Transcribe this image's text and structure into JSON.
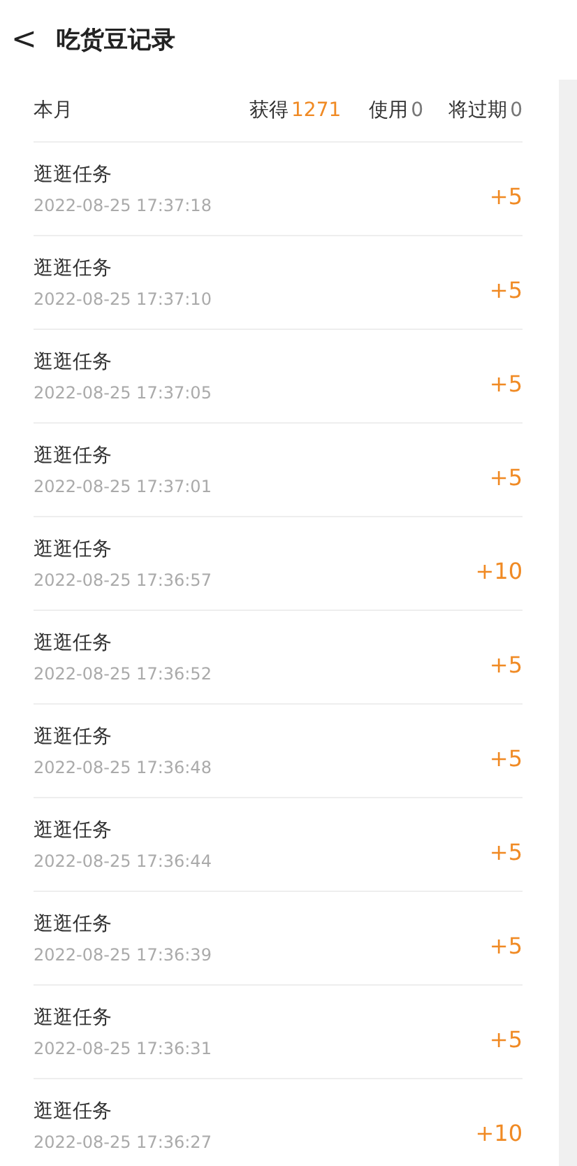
{
  "header": {
    "back": "<",
    "title": "吃货豆记录"
  },
  "summary": {
    "period": "本月",
    "earned_label": "获得",
    "earned": "1271",
    "used_label": "使用",
    "used": "0",
    "expiring_label": "将过期",
    "expiring": "0"
  },
  "records": [
    {
      "title": "逛逛任务",
      "time": "2022-08-25 17:37:18",
      "amount": "+5"
    },
    {
      "title": "逛逛任务",
      "time": "2022-08-25 17:37:10",
      "amount": "+5"
    },
    {
      "title": "逛逛任务",
      "time": "2022-08-25 17:37:05",
      "amount": "+5"
    },
    {
      "title": "逛逛任务",
      "time": "2022-08-25 17:37:01",
      "amount": "+5"
    },
    {
      "title": "逛逛任务",
      "time": "2022-08-25 17:36:57",
      "amount": "+10"
    },
    {
      "title": "逛逛任务",
      "time": "2022-08-25 17:36:52",
      "amount": "+5"
    },
    {
      "title": "逛逛任务",
      "time": "2022-08-25 17:36:48",
      "amount": "+5"
    },
    {
      "title": "逛逛任务",
      "time": "2022-08-25 17:36:44",
      "amount": "+5"
    },
    {
      "title": "逛逛任务",
      "time": "2022-08-25 17:36:39",
      "amount": "+5"
    },
    {
      "title": "逛逛任务",
      "time": "2022-08-25 17:36:31",
      "amount": "+5"
    },
    {
      "title": "逛逛任务",
      "time": "2022-08-25 17:36:27",
      "amount": "+10"
    }
  ]
}
